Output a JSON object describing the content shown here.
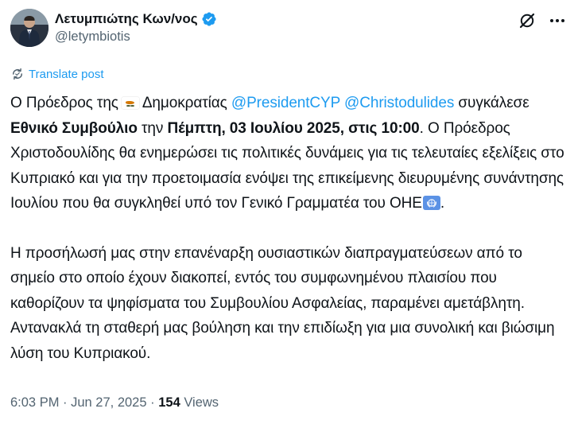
{
  "author": {
    "display_name": "Λετυμπιώτης Κων/νος",
    "handle": "@letymbiotis",
    "verified_color": "#1d9bf0"
  },
  "header_icons": {
    "grok": "grok-icon",
    "more": "more-icon"
  },
  "translate": {
    "icon": "translate-icon",
    "label": "Translate post"
  },
  "tweet": {
    "p1": {
      "t1": "Ο Πρόεδρος της",
      "flag": "cyprus-flag-emoji",
      "t2": "Δημοκρατίας",
      "mention1": "@PresidentCYP",
      "mention2": "@Christodulides",
      "t3": "συγκάλεσε",
      "b1": "Εθνικό Συμβούλιο",
      "t4": "την",
      "b2": "Πέμπτη, 03 Ιουλίου 2025, στις",
      "b3": "10:00",
      "t5": ". Ο Πρόεδρος Χριστοδουλίδης θα ενημερώσει τις πολιτικές δυνάμεις για τις τελευταίες εξελίξεις στο Κυπριακό και για την προετοιμασία ενόψει της επικείμενης διευρυμένης συνάντησης Ιουλίου που θα συγκληθεί υπό τον Γενικό Γραμματέα του ΟΗΕ",
      "un_flag": "united-nations-flag-emoji",
      "t6": "."
    },
    "p2": "Η προσήλωσή μας στην επανέναρξη ουσιαστικών διαπραγματεύσεων από το σημείο στο οποίο έχουν διακοπεί, εντός του συμφωνημένου πλαισίου που καθορίζουν τα ψηφίσματα του Συμβουλίου Ασφαλείας, παραμένει αμετάβλητη. Αντανακλά τη σταθερή μας βούληση και την επιδίωξη για μια συνολική και βιώσιμη λύση του Κυπριακού."
  },
  "meta": {
    "time": "6:03 PM",
    "sep1": " · ",
    "date": "Jun 27, 2025",
    "sep2": " · ",
    "views_count": "154",
    "views_label": " Views"
  },
  "colors": {
    "link": "#1d9bf0",
    "text": "#0f1419",
    "secondary": "#536471"
  }
}
